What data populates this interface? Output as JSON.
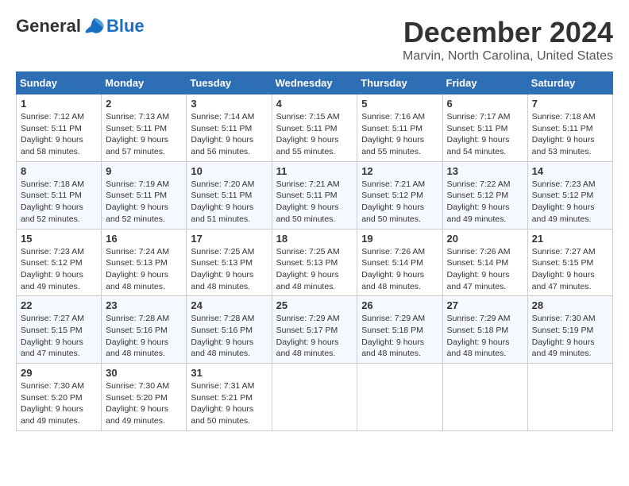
{
  "logo": {
    "general": "General",
    "blue": "Blue"
  },
  "title": "December 2024",
  "location": "Marvin, North Carolina, United States",
  "days_of_week": [
    "Sunday",
    "Monday",
    "Tuesday",
    "Wednesday",
    "Thursday",
    "Friday",
    "Saturday"
  ],
  "weeks": [
    [
      {
        "day": "1",
        "sunrise": "7:12 AM",
        "sunset": "5:11 PM",
        "daylight": "9 hours and 58 minutes."
      },
      {
        "day": "2",
        "sunrise": "7:13 AM",
        "sunset": "5:11 PM",
        "daylight": "9 hours and 57 minutes."
      },
      {
        "day": "3",
        "sunrise": "7:14 AM",
        "sunset": "5:11 PM",
        "daylight": "9 hours and 56 minutes."
      },
      {
        "day": "4",
        "sunrise": "7:15 AM",
        "sunset": "5:11 PM",
        "daylight": "9 hours and 55 minutes."
      },
      {
        "day": "5",
        "sunrise": "7:16 AM",
        "sunset": "5:11 PM",
        "daylight": "9 hours and 55 minutes."
      },
      {
        "day": "6",
        "sunrise": "7:17 AM",
        "sunset": "5:11 PM",
        "daylight": "9 hours and 54 minutes."
      },
      {
        "day": "7",
        "sunrise": "7:18 AM",
        "sunset": "5:11 PM",
        "daylight": "9 hours and 53 minutes."
      }
    ],
    [
      {
        "day": "8",
        "sunrise": "7:18 AM",
        "sunset": "5:11 PM",
        "daylight": "9 hours and 52 minutes."
      },
      {
        "day": "9",
        "sunrise": "7:19 AM",
        "sunset": "5:11 PM",
        "daylight": "9 hours and 52 minutes."
      },
      {
        "day": "10",
        "sunrise": "7:20 AM",
        "sunset": "5:11 PM",
        "daylight": "9 hours and 51 minutes."
      },
      {
        "day": "11",
        "sunrise": "7:21 AM",
        "sunset": "5:11 PM",
        "daylight": "9 hours and 50 minutes."
      },
      {
        "day": "12",
        "sunrise": "7:21 AM",
        "sunset": "5:12 PM",
        "daylight": "9 hours and 50 minutes."
      },
      {
        "day": "13",
        "sunrise": "7:22 AM",
        "sunset": "5:12 PM",
        "daylight": "9 hours and 49 minutes."
      },
      {
        "day": "14",
        "sunrise": "7:23 AM",
        "sunset": "5:12 PM",
        "daylight": "9 hours and 49 minutes."
      }
    ],
    [
      {
        "day": "15",
        "sunrise": "7:23 AM",
        "sunset": "5:12 PM",
        "daylight": "9 hours and 49 minutes."
      },
      {
        "day": "16",
        "sunrise": "7:24 AM",
        "sunset": "5:13 PM",
        "daylight": "9 hours and 48 minutes."
      },
      {
        "day": "17",
        "sunrise": "7:25 AM",
        "sunset": "5:13 PM",
        "daylight": "9 hours and 48 minutes."
      },
      {
        "day": "18",
        "sunrise": "7:25 AM",
        "sunset": "5:13 PM",
        "daylight": "9 hours and 48 minutes."
      },
      {
        "day": "19",
        "sunrise": "7:26 AM",
        "sunset": "5:14 PM",
        "daylight": "9 hours and 48 minutes."
      },
      {
        "day": "20",
        "sunrise": "7:26 AM",
        "sunset": "5:14 PM",
        "daylight": "9 hours and 47 minutes."
      },
      {
        "day": "21",
        "sunrise": "7:27 AM",
        "sunset": "5:15 PM",
        "daylight": "9 hours and 47 minutes."
      }
    ],
    [
      {
        "day": "22",
        "sunrise": "7:27 AM",
        "sunset": "5:15 PM",
        "daylight": "9 hours and 47 minutes."
      },
      {
        "day": "23",
        "sunrise": "7:28 AM",
        "sunset": "5:16 PM",
        "daylight": "9 hours and 48 minutes."
      },
      {
        "day": "24",
        "sunrise": "7:28 AM",
        "sunset": "5:16 PM",
        "daylight": "9 hours and 48 minutes."
      },
      {
        "day": "25",
        "sunrise": "7:29 AM",
        "sunset": "5:17 PM",
        "daylight": "9 hours and 48 minutes."
      },
      {
        "day": "26",
        "sunrise": "7:29 AM",
        "sunset": "5:18 PM",
        "daylight": "9 hours and 48 minutes."
      },
      {
        "day": "27",
        "sunrise": "7:29 AM",
        "sunset": "5:18 PM",
        "daylight": "9 hours and 48 minutes."
      },
      {
        "day": "28",
        "sunrise": "7:30 AM",
        "sunset": "5:19 PM",
        "daylight": "9 hours and 49 minutes."
      }
    ],
    [
      {
        "day": "29",
        "sunrise": "7:30 AM",
        "sunset": "5:20 PM",
        "daylight": "9 hours and 49 minutes."
      },
      {
        "day": "30",
        "sunrise": "7:30 AM",
        "sunset": "5:20 PM",
        "daylight": "9 hours and 49 minutes."
      },
      {
        "day": "31",
        "sunrise": "7:31 AM",
        "sunset": "5:21 PM",
        "daylight": "9 hours and 50 minutes."
      },
      null,
      null,
      null,
      null
    ]
  ]
}
